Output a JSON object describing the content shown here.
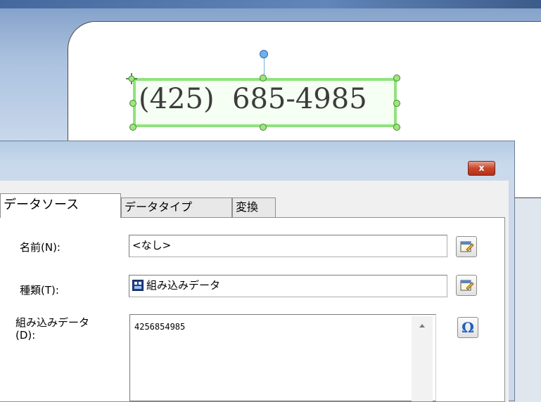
{
  "canvas": {
    "label_text": "(425)  685-4985"
  },
  "dialog": {
    "close_label": "x",
    "tabs": [
      {
        "label": "データソース",
        "active": true
      },
      {
        "label": "データタイプ",
        "active": false
      },
      {
        "label": "変換",
        "active": false
      }
    ],
    "fields": {
      "name_label": "名前(N):",
      "name_value": "<なし>",
      "type_label": "種類(T):",
      "type_value": "組み込みデータ",
      "embedded_label_line1": "組み込みデータ",
      "embedded_label_line2": "(D):",
      "embedded_value": "4256854985"
    },
    "icons": {
      "name_button": "edit-properties-icon",
      "type_button": "edit-properties-icon",
      "type_value_icon": "embedded-data-icon",
      "special_char_button": "omega-icon",
      "omega_glyph": "Ω"
    },
    "colors": {
      "selection": "#8fe37d",
      "close_button": "#c9452a"
    }
  }
}
